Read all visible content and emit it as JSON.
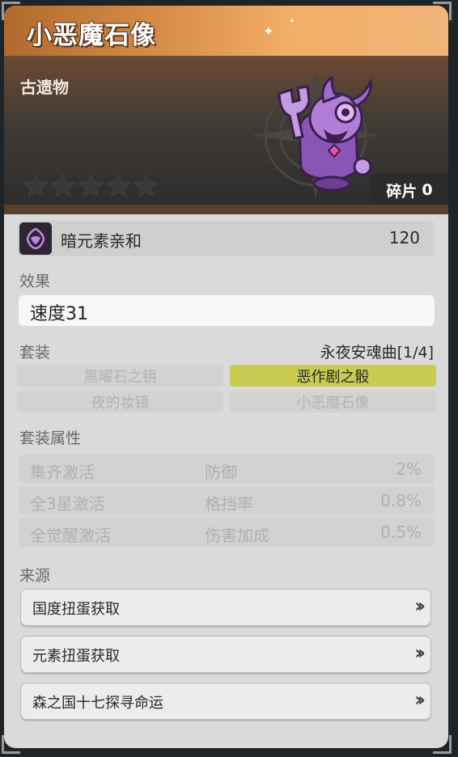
{
  "header": {
    "title": "小恶魔石像",
    "category": "古遗物",
    "star_count": 5,
    "fragments_label": "碎片",
    "fragments_value": "0"
  },
  "affinity": {
    "label": "暗元素亲和",
    "value": "120",
    "icon": "dark-element-icon"
  },
  "effect": {
    "section_label": "效果",
    "text": "速度31"
  },
  "set": {
    "section_label": "套装",
    "name": "永夜安魂曲[1/4]",
    "items": [
      {
        "label": "黑曜石之钥",
        "active": false
      },
      {
        "label": "恶作剧之骰",
        "active": true
      },
      {
        "label": "夜的妆镜",
        "active": false
      },
      {
        "label": "小恶魔石像",
        "active": false
      }
    ]
  },
  "set_attributes": {
    "section_label": "套装属性",
    "rows": [
      {
        "condition": "集齐激活",
        "attribute": "防御",
        "value": "2%"
      },
      {
        "condition": "全3星激活",
        "attribute": "格挡率",
        "value": "0.8%"
      },
      {
        "condition": "全觉醒激活",
        "attribute": "伤害加成",
        "value": "0.5%"
      }
    ]
  },
  "source": {
    "section_label": "来源",
    "items": [
      {
        "label": "国度扭蛋获取",
        "icon": "double-chevron-right-icon"
      },
      {
        "label": "元素扭蛋获取",
        "icon": "double-chevron-right-icon"
      },
      {
        "label": "森之国十七探寻命运",
        "icon": "double-chevron-right-icon"
      }
    ]
  },
  "colors": {
    "title_gradient_start": "#b06a2e",
    "title_gradient_end": "#f0b57a",
    "active_set_item": "#c9cc50",
    "panel_bg": "#dadada"
  }
}
